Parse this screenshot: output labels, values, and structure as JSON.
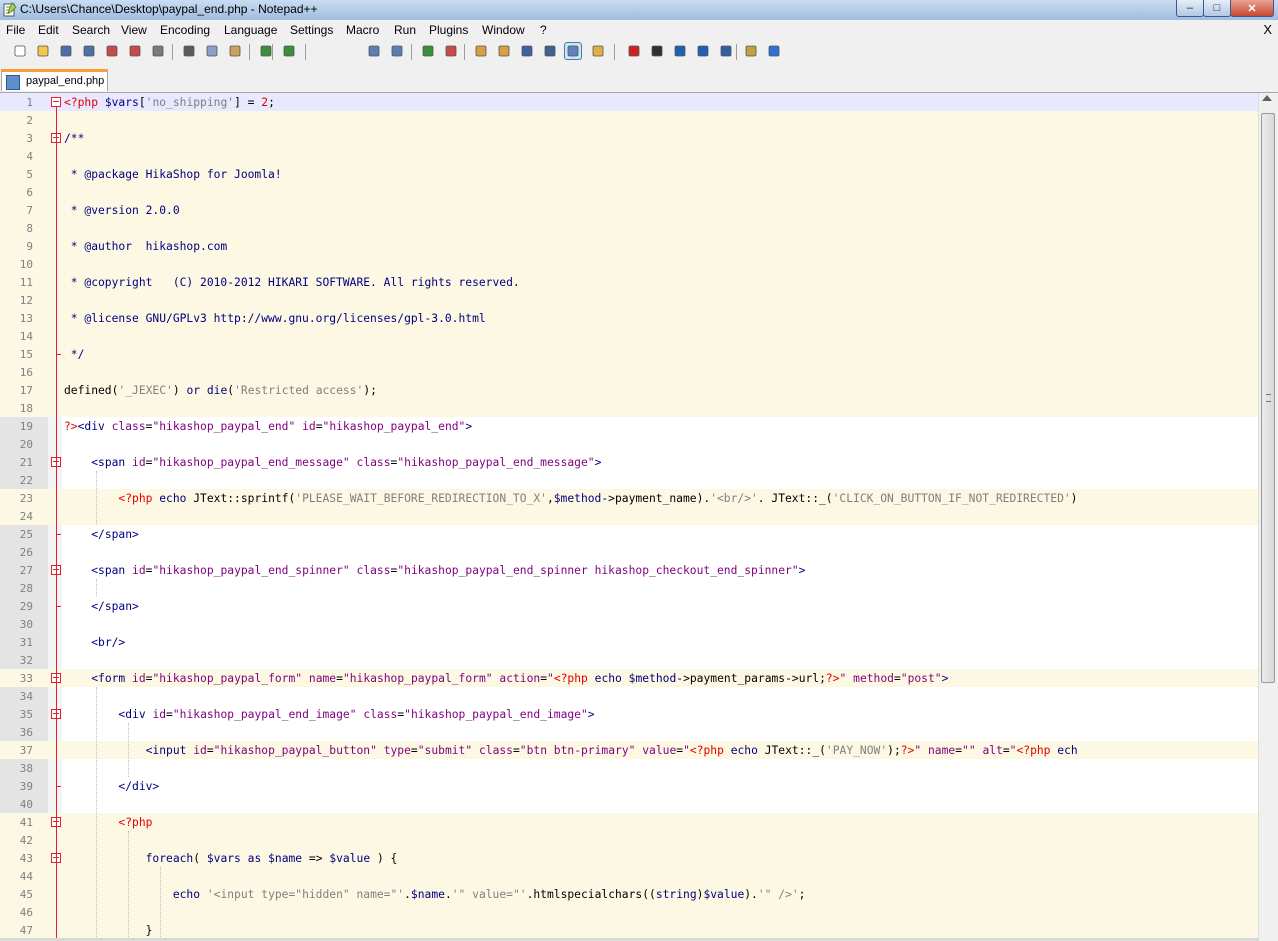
{
  "window": {
    "title": "C:\\Users\\Chance\\Desktop\\paypal_end.php - Notepad++",
    "minimize": "–",
    "maximize": "□",
    "close": "✕"
  },
  "menu": [
    "File",
    "Edit",
    "Search",
    "View",
    "Encoding",
    "Language",
    "Settings",
    "Macro",
    "Run",
    "Plugins",
    "Window",
    "?"
  ],
  "menu_close": "X",
  "toolbar_icons": [
    "new-file-icon",
    "open-file-icon",
    "save-icon",
    "save-all-icon",
    "close-icon",
    "close-all-icon",
    "print-icon",
    "cut-icon",
    "copy-icon",
    "paste-icon",
    "undo-icon",
    "redo-icon",
    "find-icon",
    "replace-icon",
    "zoom-in-icon",
    "zoom-out-icon",
    "sync-vertical-icon",
    "sync-horizontal-icon",
    "word-wrap-icon",
    "show-all-chars-icon",
    "indent-guide-icon",
    "fold-all-icon",
    "record-macro-icon",
    "stop-record-icon",
    "play-macro-icon",
    "play-multiple-icon",
    "save-macro-icon",
    "translate-icon",
    "spell-check-icon"
  ],
  "tab": {
    "label": "paypal_end.php"
  },
  "lines": [
    {
      "n": "1",
      "s": [
        [
          "ph",
          "<?php "
        ],
        [
          "var",
          "$vars"
        ],
        [
          "txt",
          "["
        ],
        [
          "sq",
          "'no_shipping'"
        ],
        [
          "txt",
          "] = "
        ],
        [
          "ph",
          "2"
        ],
        [
          "txt",
          ";"
        ]
      ]
    },
    {
      "n": "2",
      "s": []
    },
    {
      "n": "3",
      "s": [
        [
          "cm",
          "/**"
        ]
      ]
    },
    {
      "n": "4",
      "s": []
    },
    {
      "n": "5",
      "s": [
        [
          "cm",
          " * @package HikaShop for Joomla!"
        ]
      ]
    },
    {
      "n": "6",
      "s": []
    },
    {
      "n": "7",
      "s": [
        [
          "cm",
          " * @version 2.0.0"
        ]
      ]
    },
    {
      "n": "8",
      "s": []
    },
    {
      "n": "9",
      "s": [
        [
          "cm",
          " * @author  hikashop.com"
        ]
      ]
    },
    {
      "n": "10",
      "s": []
    },
    {
      "n": "11",
      "s": [
        [
          "cm",
          " * @copyright   (C) 2010-2012 HIKARI SOFTWARE. All rights reserved."
        ]
      ]
    },
    {
      "n": "12",
      "s": []
    },
    {
      "n": "13",
      "s": [
        [
          "cm",
          " * @license GNU/GPLv3 http://www.gnu.org/licenses/gpl-3.0.html"
        ]
      ]
    },
    {
      "n": "14",
      "s": []
    },
    {
      "n": "15",
      "s": [
        [
          "cm",
          " */"
        ]
      ]
    },
    {
      "n": "16",
      "s": []
    },
    {
      "n": "17",
      "s": [
        [
          "txt",
          "defined("
        ],
        [
          "sq",
          "'_JEXEC'"
        ],
        [
          "txt",
          ") "
        ],
        [
          "kw",
          "or"
        ],
        [
          "txt",
          " "
        ],
        [
          "kw",
          "die"
        ],
        [
          "txt",
          "("
        ],
        [
          "sq",
          "'Restricted access'"
        ],
        [
          "txt",
          ");"
        ]
      ]
    },
    {
      "n": "18",
      "s": []
    },
    {
      "n": "19",
      "s": [
        [
          "ph",
          "?>"
        ],
        [
          "tag",
          "<div "
        ],
        [
          "attr",
          "class"
        ],
        [
          "txt",
          "="
        ],
        [
          "str",
          "\"hikashop_paypal_end\""
        ],
        [
          "txt",
          " "
        ],
        [
          "attr",
          "id"
        ],
        [
          "txt",
          "="
        ],
        [
          "str",
          "\"hikashop_paypal_end\""
        ],
        [
          "tag",
          ">"
        ]
      ]
    },
    {
      "n": "20",
      "s": []
    },
    {
      "n": "21",
      "s": [
        [
          "txt",
          "    "
        ],
        [
          "tag",
          "<span "
        ],
        [
          "attr",
          "id"
        ],
        [
          "txt",
          "="
        ],
        [
          "str",
          "\"hikashop_paypal_end_message\""
        ],
        [
          "txt",
          " "
        ],
        [
          "attr",
          "class"
        ],
        [
          "txt",
          "="
        ],
        [
          "str",
          "\"hikashop_paypal_end_message\""
        ],
        [
          "tag",
          ">"
        ]
      ]
    },
    {
      "n": "22",
      "s": []
    },
    {
      "n": "23",
      "s": [
        [
          "txt",
          "        "
        ],
        [
          "ph",
          "<?php "
        ],
        [
          "kw",
          "echo"
        ],
        [
          "txt",
          " JText::sprintf("
        ],
        [
          "sq",
          "'PLEASE_WAIT_BEFORE_REDIRECTION_TO_X'"
        ],
        [
          "txt",
          ","
        ],
        [
          "var",
          "$method"
        ],
        [
          "txt",
          "->payment_name)."
        ],
        [
          "sq",
          "'<br/>'"
        ],
        [
          "txt",
          ". JText::_("
        ],
        [
          "sq",
          "'CLICK_ON_BUTTON_IF_NOT_REDIRECTED'"
        ],
        [
          "txt",
          ")"
        ]
      ]
    },
    {
      "n": "24",
      "s": []
    },
    {
      "n": "25",
      "s": [
        [
          "txt",
          "    "
        ],
        [
          "tag",
          "</span>"
        ]
      ]
    },
    {
      "n": "26",
      "s": []
    },
    {
      "n": "27",
      "s": [
        [
          "txt",
          "    "
        ],
        [
          "tag",
          "<span "
        ],
        [
          "attr",
          "id"
        ],
        [
          "txt",
          "="
        ],
        [
          "str",
          "\"hikashop_paypal_end_spinner\""
        ],
        [
          "txt",
          " "
        ],
        [
          "attr",
          "class"
        ],
        [
          "txt",
          "="
        ],
        [
          "str",
          "\"hikashop_paypal_end_spinner hikashop_checkout_end_spinner\""
        ],
        [
          "tag",
          ">"
        ]
      ]
    },
    {
      "n": "28",
      "s": []
    },
    {
      "n": "29",
      "s": [
        [
          "txt",
          "    "
        ],
        [
          "tag",
          "</span>"
        ]
      ]
    },
    {
      "n": "30",
      "s": []
    },
    {
      "n": "31",
      "s": [
        [
          "txt",
          "    "
        ],
        [
          "tag",
          "<br/>"
        ]
      ]
    },
    {
      "n": "32",
      "s": []
    },
    {
      "n": "33",
      "s": [
        [
          "txt",
          "    "
        ],
        [
          "tag",
          "<form "
        ],
        [
          "attr",
          "id"
        ],
        [
          "txt",
          "="
        ],
        [
          "str",
          "\"hikashop_paypal_form\""
        ],
        [
          "txt",
          " "
        ],
        [
          "attr",
          "name"
        ],
        [
          "txt",
          "="
        ],
        [
          "str",
          "\"hikashop_paypal_form\""
        ],
        [
          "txt",
          " "
        ],
        [
          "attr",
          "action"
        ],
        [
          "txt",
          "="
        ],
        [
          "str",
          "\""
        ],
        [
          "ph",
          "<?php "
        ],
        [
          "kw",
          "echo"
        ],
        [
          "txt",
          " "
        ],
        [
          "var",
          "$method"
        ],
        [
          "txt",
          "->payment_params->url;"
        ],
        [
          "ph",
          "?>"
        ],
        [
          "str",
          "\""
        ],
        [
          "txt",
          " "
        ],
        [
          "attr",
          "method"
        ],
        [
          "txt",
          "="
        ],
        [
          "str",
          "\"post\""
        ],
        [
          "tag",
          ">"
        ]
      ]
    },
    {
      "n": "34",
      "s": []
    },
    {
      "n": "35",
      "s": [
        [
          "txt",
          "        "
        ],
        [
          "tag",
          "<div "
        ],
        [
          "attr",
          "id"
        ],
        [
          "txt",
          "="
        ],
        [
          "str",
          "\"hikashop_paypal_end_image\""
        ],
        [
          "txt",
          " "
        ],
        [
          "attr",
          "class"
        ],
        [
          "txt",
          "="
        ],
        [
          "str",
          "\"hikashop_paypal_end_image\""
        ],
        [
          "tag",
          ">"
        ]
      ]
    },
    {
      "n": "36",
      "s": []
    },
    {
      "n": "37",
      "s": [
        [
          "txt",
          "            "
        ],
        [
          "tag",
          "<input "
        ],
        [
          "attr",
          "id"
        ],
        [
          "txt",
          "="
        ],
        [
          "str",
          "\"hikashop_paypal_button\""
        ],
        [
          "txt",
          " "
        ],
        [
          "attr",
          "type"
        ],
        [
          "txt",
          "="
        ],
        [
          "str",
          "\"submit\""
        ],
        [
          "txt",
          " "
        ],
        [
          "attr",
          "class"
        ],
        [
          "txt",
          "="
        ],
        [
          "str",
          "\"btn btn-primary\""
        ],
        [
          "txt",
          " "
        ],
        [
          "attr",
          "value"
        ],
        [
          "txt",
          "="
        ],
        [
          "str",
          "\""
        ],
        [
          "ph",
          "<?php "
        ],
        [
          "kw",
          "echo"
        ],
        [
          "txt",
          " JText::_("
        ],
        [
          "sq",
          "'PAY_NOW'"
        ],
        [
          "txt",
          ");"
        ],
        [
          "ph",
          "?>"
        ],
        [
          "str",
          "\""
        ],
        [
          "txt",
          " "
        ],
        [
          "attr",
          "name"
        ],
        [
          "txt",
          "="
        ],
        [
          "str",
          "\"\""
        ],
        [
          "txt",
          " "
        ],
        [
          "attr",
          "alt"
        ],
        [
          "txt",
          "="
        ],
        [
          "str",
          "\""
        ],
        [
          "ph",
          "<?php "
        ],
        [
          "kw",
          "ech"
        ]
      ]
    },
    {
      "n": "38",
      "s": []
    },
    {
      "n": "39",
      "s": [
        [
          "txt",
          "        "
        ],
        [
          "tag",
          "</div>"
        ]
      ]
    },
    {
      "n": "40",
      "s": []
    },
    {
      "n": "41",
      "s": [
        [
          "txt",
          "        "
        ],
        [
          "ph",
          "<?php"
        ]
      ]
    },
    {
      "n": "42",
      "s": []
    },
    {
      "n": "43",
      "s": [
        [
          "txt",
          "            "
        ],
        [
          "kw",
          "foreach"
        ],
        [
          "txt",
          "( "
        ],
        [
          "var",
          "$vars"
        ],
        [
          "txt",
          " "
        ],
        [
          "kw",
          "as"
        ],
        [
          "txt",
          " "
        ],
        [
          "var",
          "$name"
        ],
        [
          "txt",
          " => "
        ],
        [
          "var",
          "$value"
        ],
        [
          "txt",
          " ) {"
        ]
      ]
    },
    {
      "n": "44",
      "s": []
    },
    {
      "n": "45",
      "s": [
        [
          "txt",
          "                "
        ],
        [
          "kw",
          "echo"
        ],
        [
          "txt",
          " "
        ],
        [
          "sq",
          "'<input type=\"hidden\" name=\"'"
        ],
        [
          "txt",
          "."
        ],
        [
          "var",
          "$name"
        ],
        [
          "txt",
          "."
        ],
        [
          "sq",
          "'\" value=\"'"
        ],
        [
          "txt",
          ".htmlspecialchars(("
        ],
        [
          "kw",
          "string"
        ],
        [
          "txt",
          ")"
        ],
        [
          "var",
          "$value"
        ],
        [
          "txt",
          ")."
        ],
        [
          "sq",
          "'\" />'"
        ],
        [
          "txt",
          ";"
        ]
      ]
    },
    {
      "n": "46",
      "s": []
    },
    {
      "n": "47",
      "s": [
        [
          "txt",
          "            }"
        ]
      ]
    }
  ]
}
